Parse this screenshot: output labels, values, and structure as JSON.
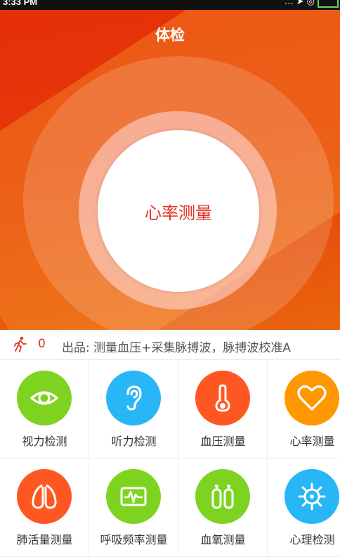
{
  "status_bar": {
    "time": "3:33 PM",
    "icons": [
      "signal-icon",
      "location-icon",
      "wifi-icon",
      "battery-icon"
    ]
  },
  "header": {
    "title": "体检",
    "measure_button": "心率测量"
  },
  "ticker": {
    "count": "0",
    "text": "出品: 测量血压+采集脉搏波，脉搏波校准A"
  },
  "colors": {
    "header_red": "#e52f08",
    "header_orange": "#e9650d",
    "accent_red": "#e53024",
    "green": "#7ed321",
    "blue": "#29b6f6",
    "orange_red": "#ff5722",
    "amber": "#ff9800"
  },
  "tiles": [
    {
      "label": "视力检测",
      "icon": "eye-icon",
      "color": "#7ed321"
    },
    {
      "label": "听力检测",
      "icon": "ear-icon",
      "color": "#29b6f6"
    },
    {
      "label": "血压测量",
      "icon": "thermometer-icon",
      "color": "#ff5722"
    },
    {
      "label": "心率测量",
      "icon": "heart-icon",
      "color": "#ff9800"
    },
    {
      "label": "肺活量测量",
      "icon": "lungs-icon",
      "color": "#ff5722"
    },
    {
      "label": "呼吸频率测量",
      "icon": "waveform-icon",
      "color": "#7ed321"
    },
    {
      "label": "血氧测量",
      "icon": "oxygen-tanks-icon",
      "color": "#7ed321"
    },
    {
      "label": "心理检测",
      "icon": "helm-icon",
      "color": "#29b6f6"
    }
  ]
}
